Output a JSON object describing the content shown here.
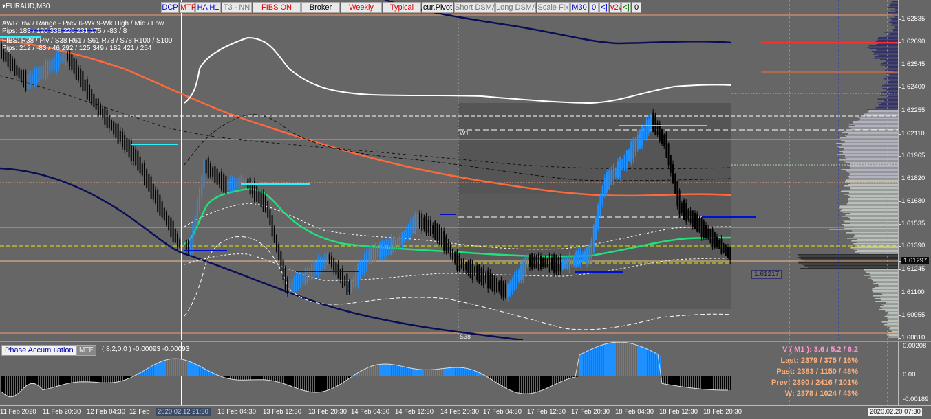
{
  "window": {
    "title": "EURAUD,M30"
  },
  "toolbar": [
    {
      "label": "DCP",
      "style": "blue"
    },
    {
      "label": "MTF",
      "style": "red"
    },
    {
      "label": "HA H1",
      "style": "blue"
    },
    {
      "label": "T3 - NN",
      "style": "gray"
    },
    {
      "label": "FIBS ON",
      "style": "red"
    },
    {
      "label": "Broker",
      "style": "plain"
    },
    {
      "label": "Weekly",
      "style": "red"
    },
    {
      "label": "Typical",
      "style": "red"
    },
    {
      "label": "cur.Pivot",
      "style": "plain"
    },
    {
      "label": "Short DSMA",
      "style": "gray"
    },
    {
      "label": "Long DSMA",
      "style": "gray"
    },
    {
      "label": "Scale Fix",
      "style": "gray"
    },
    {
      "label": "M30",
      "style": "blue"
    },
    {
      "label": "0",
      "style": "blue"
    },
    {
      "label": "<]",
      "style": "blue"
    },
    {
      "label": "v2v",
      "style": "red"
    },
    {
      "label": "<]",
      "style": "green"
    },
    {
      "label": "0",
      "style": "plain"
    }
  ],
  "info_panel": {
    "row1": "AWR: 6w / Range - Prev      6-Wk      9-Wk      High / Mid / Low",
    "row2_label": "Pips:",
    "row2_values": "183 / 120      338      226      231      175  /  -83  /  8",
    "row3": "FIBS: R38 / Piv / S38    R61 / S61    R78 / S78    R100 / S100",
    "row4_label": "Pips:",
    "row4_values": "212  /  -83  /  46      292 / 125      349  /  182      421  /  254"
  },
  "chart_labels": {
    "week_label": "W1",
    "s38_label": "S38",
    "last_price_box": "1.61217"
  },
  "price_scale": {
    "ticks": [
      "1.62835",
      "1.62690",
      "1.62545",
      "1.62400",
      "1.62255",
      "1.62110",
      "1.61965",
      "1.61820",
      "1.61680",
      "1.61535",
      "1.61390",
      "1.61297",
      "1.61245",
      "1.61100",
      "1.60955",
      "1.60810"
    ],
    "highlighted": "1.61297"
  },
  "sub_scale": {
    "ticks": [
      "0.00208",
      "0.00",
      "-0.00189"
    ]
  },
  "indicator": {
    "name": "Phase Accumulation",
    "mtf": "MTF",
    "params": "( 8,2,0.0 ) -0.00093 -0.00093"
  },
  "stats": [
    {
      "text": "V ( M1 ): 3.6 / 5.2 / 6.2",
      "color": "#ff99cc"
    },
    {
      "text": "Last: 2379 / 375 / 16%",
      "color": "#ffb07a"
    },
    {
      "text": "Past: 2383 / 1150 / 48%",
      "color": "#ffb07a"
    },
    {
      "text": "Prev: 2390 / 2416 / 101%",
      "color": "#ffb07a"
    },
    {
      "text": "W: 2378 / 1024 / 43%",
      "color": "#ffb07a"
    }
  ],
  "time_axis": {
    "labels": [
      "11 Feb 2020",
      "11 Feb 20:30",
      "12 Feb 04:30",
      "12 Feb",
      "2020.02.12 21:30",
      "13 Feb 04:30",
      "13 Feb 12:30",
      "13 Feb 20:30",
      "14 Feb 04:30",
      "14 Feb 12:30",
      "14 Feb 20:30",
      "17 Feb 04:30",
      "17 Feb 12:30",
      "17 Feb 20:30",
      "18 Feb 04:30",
      "18 Feb 12:30",
      "18 Feb 20:30"
    ],
    "highlighted": "2020.02.12 21:30",
    "corner": "2020.02.20 07:30"
  },
  "colors": {
    "background": "#666666",
    "bull_candle": "#1e90ff",
    "bear_candle": "#000000",
    "ma_orange": "#ff6a3c",
    "ma_green": "#22e07a",
    "ma_navy": "#0a0f55",
    "band_white": "#ffffff",
    "level_orange": "#f2a06e",
    "level_yellow": "#e6e600",
    "cyan": "#2ef0ff",
    "blue_level": "#0010cc"
  }
}
